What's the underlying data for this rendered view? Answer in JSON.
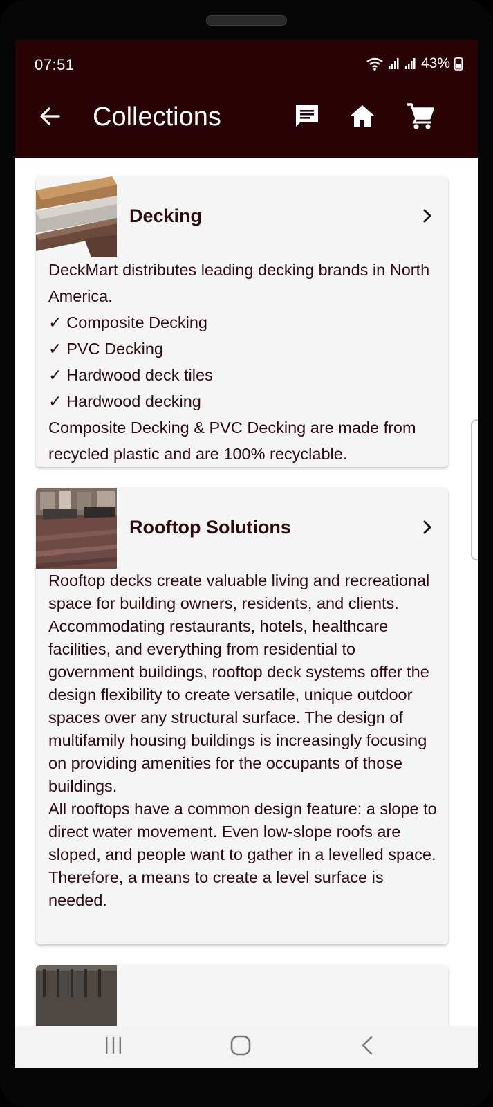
{
  "status_bar": {
    "time": "07:51",
    "battery": "43%",
    "icons": [
      "wifi-icon",
      "signal-icon",
      "signal-icon",
      "battery-icon"
    ]
  },
  "app_bar": {
    "title": "Collections",
    "back_icon": "arrow-left-icon",
    "actions": [
      "chat-icon",
      "home-icon",
      "cart-icon"
    ],
    "background": "#2a0307"
  },
  "collections": [
    {
      "title": "Decking",
      "description": "DeckMart distributes leading decking brands in North America.\n✓ Composite Decking\n✓ PVC Decking\n✓ Hardwood deck tiles\n✓ Hardwood decking\n Composite Decking & PVC Decking are made from recycled plastic and are 100% recyclable."
    },
    {
      "title": "Rooftop Solutions",
      "description": "Rooftop decks create valuable living and recreational space for building owners, residents, and clients. Accommodating restaurants, hotels, healthcare facilities, and everything from residential to government buildings, rooftop deck systems offer the design flexibility to create versatile, unique outdoor spaces over any structural surface. The design of multifamily housing buildings is increasingly focusing on providing amenities for the occupants of those buildings.\nAll rooftops have a common design feature: a slope to direct water movement. Even low-slope roofs are sloped, and people want to gather in a levelled space. Therefore, a means to create a level surface is needed."
    }
  ],
  "nav_bar": {
    "buttons": [
      "recents-icon",
      "home-button-icon",
      "back-chevron-icon"
    ]
  },
  "colors": {
    "accent": "#2a0307",
    "text": "#2c0a10",
    "card": "#f5f5f5"
  }
}
